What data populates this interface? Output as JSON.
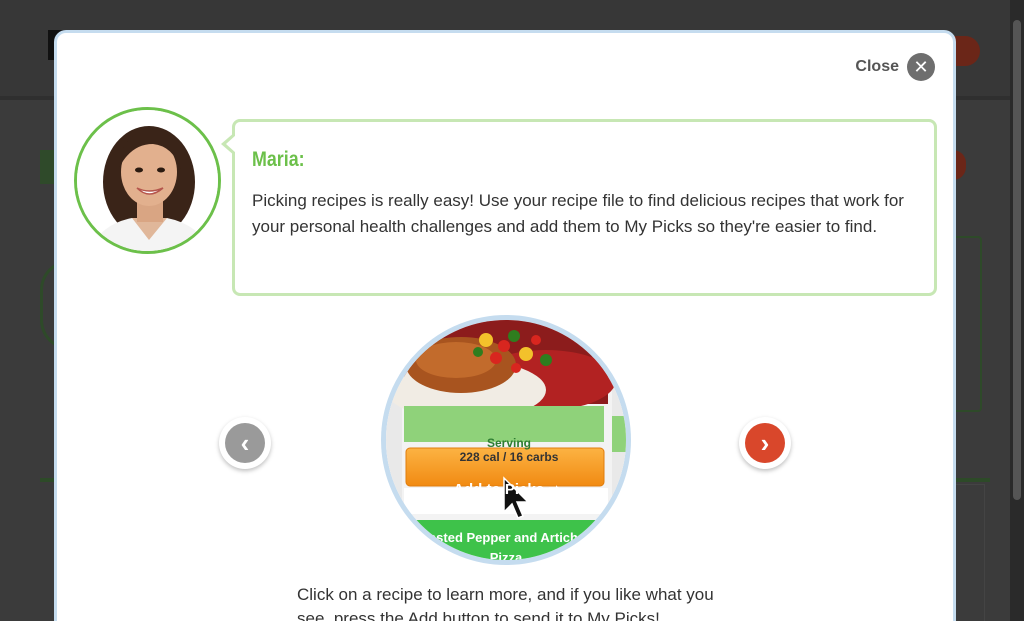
{
  "modal": {
    "close_label": "Close",
    "close_icon": "close-icon"
  },
  "guide": {
    "name": "Maria:",
    "message": "Picking recipes is really easy! Use your recipe file to find delicious recipes that work for your personal health challenges and add them to My Picks so they're easier to find."
  },
  "preview": {
    "serving_label": "Serving",
    "serving_value": "228 cal / 16 carbs",
    "add_button_label": "Add to Picks",
    "recipe_title_line1": "Roasted Pepper and Artichoke",
    "recipe_title_line2": "Pizza"
  },
  "navigation": {
    "prev_icon": "chevron-left-icon",
    "next_icon": "chevron-right-icon"
  },
  "instructions": "Click on a recipe to learn more, and if you like what you see, press the Add button to send it to My Picks!",
  "colors": {
    "accent_green": "#6cc04a",
    "bubble_border": "#c7e7b4",
    "modal_border": "#c5dcef",
    "next_arrow": "#d9472b",
    "prev_arrow": "#9a9a9a",
    "add_button": "#f7941d",
    "serving_bg": "#8fd27a"
  }
}
